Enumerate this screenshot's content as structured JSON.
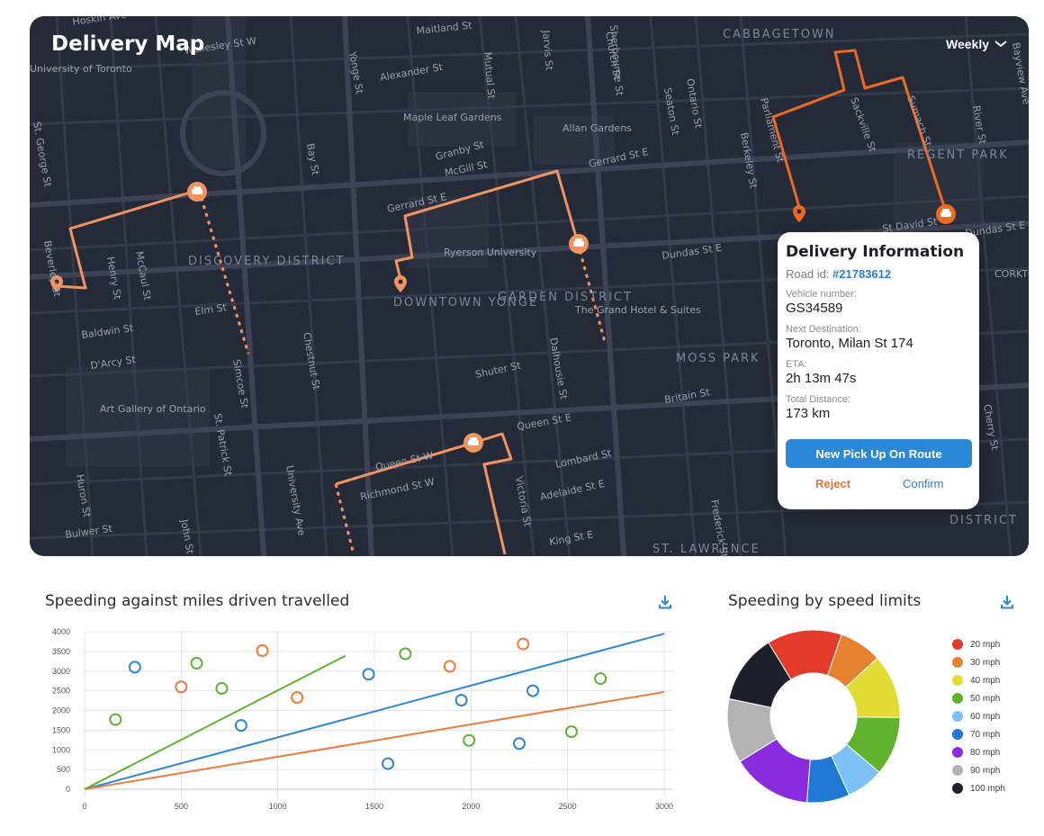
{
  "map": {
    "title": "Delivery Map",
    "period": "Weekly",
    "labels": {
      "street_labels": [
        "Hoskin Ave",
        "Wellesley St W",
        "University of Toronto",
        "Alexander St",
        "Maitland St",
        "Mutual St",
        "Jarvis St",
        "Sherbourne St",
        "CABBAGETOWN",
        "Bayview Ave",
        "Maple Leaf Gardens",
        "Allan Gardens",
        "Parliament St",
        "Sackville St",
        "Sumach St",
        "River St",
        "Granby St",
        "McGill St",
        "Gerrard St E",
        "Gerrard St E",
        "REGENT PARK",
        "St. George St",
        "Bay St",
        "Yonge St",
        "Church St",
        "Seaton St",
        "Ontario St",
        "Berkeley St",
        "St David St",
        "Dundas St E",
        "Dundas St E",
        "Ryerson University",
        "DISCOVERY DISTRICT",
        "DOWNTOWN YONGE",
        "GARDEN DISTRICT",
        "Henry St",
        "McCaul St",
        "Beverley St",
        "Elm St",
        "Baldwin St",
        "D'Arcy St",
        "Simcoe St",
        "Chestnut St",
        "Shuter St",
        "Dalhousie St",
        "The Grand Hotel & Suites",
        "MOSS PARK",
        "Britain St",
        "Art Gallery of Ontario",
        "St. Patrick St",
        "Queen St E",
        "Queen St W",
        "Richmond St W",
        "Adelaide St E",
        "Lombard St",
        "Victoria St",
        "Huron St",
        "Bulwer St",
        "John St",
        "University Ave",
        "King St E",
        "ST. LAWRENCE",
        "Frederick St",
        "DISTRICT",
        "CORKTOWN",
        "Cherry St"
      ]
    }
  },
  "delivery_info": {
    "title": "Delivery Information",
    "road_label": "Road id:",
    "road_id": "#21783612",
    "vehicle_label": "Vehicle number:",
    "vehicle_value": "GS34589",
    "next_dest_label": "Next Destination:",
    "next_dest_value": "Toronto, Milan St 174",
    "eta_label": "ETA:",
    "eta_value": "2h 13m 47s",
    "distance_label": "Total Distance:",
    "distance_value": "173 km",
    "primary_button": "New Pick Up On Route",
    "reject_button": "Reject",
    "confirm_button": "Confirm"
  },
  "scatter_panel": {
    "title": "Speeding against miles driven travelled"
  },
  "pie_panel": {
    "title": "Speeding by speed limits"
  },
  "colors": {
    "accent": "#2b87d8",
    "route_orange": "#ee7a3b",
    "route_light": "#f19460",
    "map_bg": "#252a38"
  },
  "chart_data": [
    {
      "type": "scatter",
      "title": "Speeding against miles driven travelled",
      "xlim": [
        0,
        3000
      ],
      "ylim": [
        0,
        4000
      ],
      "x_ticks": [
        0,
        500,
        1000,
        1500,
        2000,
        2500,
        3000
      ],
      "y_ticks": [
        0,
        500,
        1000,
        1500,
        2000,
        2500,
        3000,
        3500,
        4000
      ],
      "grid": true,
      "series": [
        {
          "color": "#2b87d8",
          "points": [
            [
              260,
              3100
            ],
            [
              810,
              1620
            ],
            [
              1470,
              2920
            ],
            [
              1570,
              650
            ],
            [
              1950,
              2260
            ],
            [
              2250,
              1160
            ],
            [
              2320,
              2500
            ]
          ],
          "trend": [
            [
              0,
              0
            ],
            [
              3000,
              3950
            ]
          ]
        },
        {
          "color": "#ee7a3b",
          "points": [
            [
              500,
              2600
            ],
            [
              920,
              3520
            ],
            [
              1100,
              2330
            ],
            [
              1890,
              3120
            ],
            [
              2270,
              3690
            ]
          ],
          "trend": [
            [
              0,
              0
            ],
            [
              3000,
              2470
            ]
          ]
        },
        {
          "color": "#5cb531",
          "points": [
            [
              160,
              1770
            ],
            [
              580,
              3200
            ],
            [
              710,
              2560
            ],
            [
              1660,
              3440
            ],
            [
              1990,
              1240
            ],
            [
              2520,
              1460
            ],
            [
              2670,
              2810
            ]
          ],
          "trend": [
            [
              0,
              0
            ],
            [
              1350,
              3390
            ]
          ]
        }
      ]
    },
    {
      "type": "pie",
      "title": "Speeding by speed limits",
      "labels": [
        "20 mph",
        "30 mph",
        "40 mph",
        "50 mph",
        "60 mph",
        "70 mph",
        "80 mph",
        "90 mph",
        "100 mph"
      ],
      "values": [
        14,
        8,
        12,
        11,
        7,
        8,
        15,
        12,
        13
      ],
      "colors": [
        "#e23b2c",
        "#e48230",
        "#e1db33",
        "#61b32d",
        "#7cc1f5",
        "#1f78d4",
        "#8b2be0",
        "#b3b3b3",
        "#1b202b"
      ],
      "donut": true
    }
  ]
}
